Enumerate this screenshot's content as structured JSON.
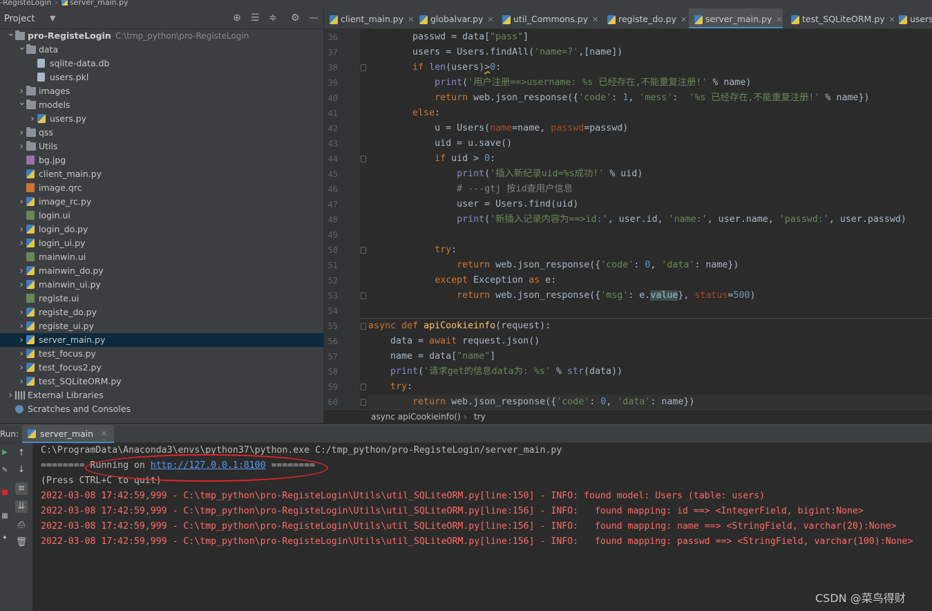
{
  "titlebar": {
    "project": "-RegisteLogin",
    "file": "server_main.py"
  },
  "project_panel": {
    "title": "Project"
  },
  "tree": [
    {
      "label": "pro-RegisteLogin",
      "path": "C:\\tmp_python\\pro-RegisteLogin",
      "depth": 0,
      "arrow": "open",
      "icon": "folder-icon",
      "bold": true
    },
    {
      "label": "data",
      "depth": 1,
      "arrow": "open",
      "icon": "folder-icon"
    },
    {
      "label": "sqlite-data.db",
      "depth": 2,
      "arrow": "none",
      "icon": "database-file-icon"
    },
    {
      "label": "users.pkl",
      "depth": 2,
      "arrow": "none",
      "icon": "file-icon"
    },
    {
      "label": "images",
      "depth": 1,
      "arrow": "closed",
      "icon": "folder-icon"
    },
    {
      "label": "models",
      "depth": 1,
      "arrow": "open",
      "icon": "folder-icon"
    },
    {
      "label": "users.py",
      "depth": 2,
      "arrow": "closed",
      "icon": "python-file-icon"
    },
    {
      "label": "qss",
      "depth": 1,
      "arrow": "closed",
      "icon": "folder-icon"
    },
    {
      "label": "Utils",
      "depth": 1,
      "arrow": "closed",
      "icon": "folder-icon"
    },
    {
      "label": "bg.jpg",
      "depth": 1,
      "arrow": "none",
      "icon": "image-file-icon"
    },
    {
      "label": "client_main.py",
      "depth": 1,
      "arrow": "none",
      "icon": "python-file-icon"
    },
    {
      "label": "image.qrc",
      "depth": 1,
      "arrow": "none",
      "icon": "qrc-file-icon"
    },
    {
      "label": "image_rc.py",
      "depth": 1,
      "arrow": "closed",
      "icon": "python-file-icon"
    },
    {
      "label": "login.ui",
      "depth": 1,
      "arrow": "none",
      "icon": "ui-file-icon"
    },
    {
      "label": "login_do.py",
      "depth": 1,
      "arrow": "closed",
      "icon": "python-file-icon"
    },
    {
      "label": "login_ui.py",
      "depth": 1,
      "arrow": "closed",
      "icon": "python-file-icon"
    },
    {
      "label": "mainwin.ui",
      "depth": 1,
      "arrow": "none",
      "icon": "ui-file-icon"
    },
    {
      "label": "mainwin_do.py",
      "depth": 1,
      "arrow": "closed",
      "icon": "python-file-icon"
    },
    {
      "label": "mainwin_ui.py",
      "depth": 1,
      "arrow": "closed",
      "icon": "python-file-icon"
    },
    {
      "label": "registe.ui",
      "depth": 1,
      "arrow": "none",
      "icon": "ui-file-icon"
    },
    {
      "label": "registe_do.py",
      "depth": 1,
      "arrow": "closed",
      "icon": "python-file-icon"
    },
    {
      "label": "registe_ui.py",
      "depth": 1,
      "arrow": "closed",
      "icon": "python-file-icon"
    },
    {
      "label": "server_main.py",
      "depth": 1,
      "arrow": "closed",
      "icon": "python-file-icon",
      "selected": true
    },
    {
      "label": "test_focus.py",
      "depth": 1,
      "arrow": "closed",
      "icon": "python-file-icon"
    },
    {
      "label": "test_focus2.py",
      "depth": 1,
      "arrow": "closed",
      "icon": "python-file-icon"
    },
    {
      "label": "test_SQLiteORM.py",
      "depth": 1,
      "arrow": "closed",
      "icon": "python-file-icon"
    },
    {
      "label": "External Libraries",
      "depth": 0,
      "arrow": "closed",
      "icon": "library-icon"
    },
    {
      "label": "Scratches and Consoles",
      "depth": 0,
      "arrow": "none",
      "icon": "scratches-icon"
    }
  ],
  "tabs": [
    {
      "label": "client_main.py",
      "active": false
    },
    {
      "label": "globalvar.py",
      "active": false
    },
    {
      "label": "util_Commons.py",
      "active": false
    },
    {
      "label": "registe_do.py",
      "active": false
    },
    {
      "label": "server_main.py",
      "active": true
    },
    {
      "label": "test_SQLiteORM.py",
      "active": false
    },
    {
      "label": "users",
      "active": false
    }
  ],
  "line_numbers": [
    "36",
    "37",
    "38",
    "39",
    "40",
    "41",
    "42",
    "43",
    "44",
    "45",
    "46",
    "47",
    "48",
    "49",
    "50",
    "51",
    "52",
    "53",
    "54",
    "55",
    "56",
    "57",
    "58",
    "59",
    "60"
  ],
  "code_lines": [
    {
      "indent": "        ",
      "tokens": [
        [
          "",
          "passwd = data["
        ],
        [
          "st",
          "\"pass\""
        ],
        [
          "",
          "]"
        ]
      ]
    },
    {
      "indent": "        ",
      "tokens": [
        [
          "",
          "users = Users.findAll("
        ],
        [
          "st",
          "'name=?'"
        ],
        [
          "",
          ",[name])"
        ]
      ]
    },
    {
      "indent": "        ",
      "tokens": [
        [
          "kw",
          "if "
        ],
        [
          "bi",
          "len"
        ],
        [
          "",
          "(users)"
        ],
        [
          "und",
          ">"
        ],
        [
          "nu",
          "0"
        ],
        [
          "",
          ":"
        ]
      ]
    },
    {
      "indent": "            ",
      "tokens": [
        [
          "bi",
          "print"
        ],
        [
          "",
          "("
        ],
        [
          "st",
          "'用户注册==>username: %s 已经存在,不能重复注册!'"
        ],
        [
          "",
          " % name)"
        ]
      ]
    },
    {
      "indent": "            ",
      "tokens": [
        [
          "kw",
          "return "
        ],
        [
          "",
          "web.json_response({"
        ],
        [
          "st",
          "'code'"
        ],
        [
          "",
          ": "
        ],
        [
          "nu",
          "1"
        ],
        [
          "",
          ", "
        ],
        [
          "st",
          "'mess'"
        ],
        [
          "",
          ":  "
        ],
        [
          "st",
          "'%s 已经存在,不能重复注册!'"
        ],
        [
          "",
          " % name})"
        ]
      ]
    },
    {
      "indent": "        ",
      "tokens": [
        [
          "kw",
          "else"
        ],
        [
          "",
          ":"
        ]
      ]
    },
    {
      "indent": "            ",
      "tokens": [
        [
          "",
          "u = Users("
        ],
        [
          "pa",
          "name"
        ],
        [
          "",
          "=name, "
        ],
        [
          "pa",
          "passwd"
        ],
        [
          "",
          "=passwd)"
        ]
      ]
    },
    {
      "indent": "            ",
      "tokens": [
        [
          "",
          "uid = u.save()"
        ]
      ]
    },
    {
      "indent": "            ",
      "tokens": [
        [
          "kw",
          "if "
        ],
        [
          "",
          "uid > "
        ],
        [
          "nu",
          "0"
        ],
        [
          "",
          ":"
        ]
      ]
    },
    {
      "indent": "                ",
      "tokens": [
        [
          "bi",
          "print"
        ],
        [
          "",
          "("
        ],
        [
          "st",
          "'插入新纪录uid=%s成功!'"
        ],
        [
          "",
          " % uid)"
        ]
      ]
    },
    {
      "indent": "                ",
      "tokens": [
        [
          "cm",
          "# ---gtj 按id查用户信息"
        ]
      ]
    },
    {
      "indent": "                ",
      "tokens": [
        [
          "",
          "user = Users.find(uid)"
        ]
      ]
    },
    {
      "indent": "                ",
      "tokens": [
        [
          "bi",
          "print"
        ],
        [
          "",
          "("
        ],
        [
          "st",
          "'新插入记录内容为==>id:'"
        ],
        [
          "",
          ", user.id, "
        ],
        [
          "st",
          "'name:'"
        ],
        [
          "",
          ", user.name, "
        ],
        [
          "st",
          "'passwd:'"
        ],
        [
          "",
          ", user.passwd)"
        ]
      ]
    },
    {
      "indent": "",
      "tokens": []
    },
    {
      "indent": "            ",
      "tokens": [
        [
          "kw",
          "try"
        ],
        [
          "",
          ":"
        ]
      ]
    },
    {
      "indent": "                ",
      "tokens": [
        [
          "kw",
          "return "
        ],
        [
          "",
          "web.json_response({"
        ],
        [
          "st",
          "'code'"
        ],
        [
          "",
          ": "
        ],
        [
          "nu",
          "0"
        ],
        [
          "",
          ", "
        ],
        [
          "st",
          "'data'"
        ],
        [
          "",
          ": name})"
        ]
      ]
    },
    {
      "indent": "            ",
      "tokens": [
        [
          "kw",
          "except "
        ],
        [
          "",
          "Exception "
        ],
        [
          "kw",
          "as "
        ],
        [
          "",
          "e:"
        ]
      ]
    },
    {
      "indent": "                ",
      "tokens": [
        [
          "kw",
          "return "
        ],
        [
          "",
          "web.json_response({"
        ],
        [
          "st",
          "'msg'"
        ],
        [
          "",
          ": e."
        ],
        [
          "hl",
          "value"
        ],
        [
          "",
          "}, "
        ],
        [
          "pa",
          "status"
        ],
        [
          "",
          "="
        ],
        [
          "nu",
          "500"
        ],
        [
          "",
          ")"
        ]
      ]
    },
    {
      "indent": "",
      "tokens": []
    },
    {
      "indent": "",
      "tokens": [
        [
          "kw",
          "async def "
        ],
        [
          "fn",
          "apiCookieinfo"
        ],
        [
          "",
          "(request):"
        ]
      ]
    },
    {
      "indent": "    ",
      "tokens": [
        [
          "",
          "data = "
        ],
        [
          "kw",
          "await "
        ],
        [
          "",
          "request.json()"
        ]
      ]
    },
    {
      "indent": "    ",
      "tokens": [
        [
          "",
          "name = data["
        ],
        [
          "st",
          "\"name\""
        ],
        [
          "",
          "]"
        ]
      ]
    },
    {
      "indent": "    ",
      "tokens": [
        [
          "bi",
          "print"
        ],
        [
          "",
          "("
        ],
        [
          "st",
          "'请求get的信息data为: %s'"
        ],
        [
          "",
          " % "
        ],
        [
          "bi",
          "str"
        ],
        [
          "",
          "(data))"
        ]
      ]
    },
    {
      "indent": "    ",
      "tokens": [
        [
          "kw",
          "try"
        ],
        [
          "",
          ":"
        ]
      ]
    },
    {
      "indent": "        ",
      "tokens": [
        [
          "kw",
          "return "
        ],
        [
          "",
          "web.json_response({"
        ],
        [
          "st",
          "'code'"
        ],
        [
          "",
          ": "
        ],
        [
          "nu",
          "0"
        ],
        [
          "",
          ", "
        ],
        [
          "st",
          "'data'"
        ],
        [
          "",
          ": name})"
        ]
      ],
      "current": true
    }
  ],
  "breadcrumb": {
    "item1": "async apiCookieinfo()",
    "sep": "›",
    "item2": "try"
  },
  "run": {
    "label": "Run:",
    "tab": "server_main",
    "lines": [
      {
        "text": "C:\\ProgramData\\Anaconda3\\envs\\python37\\python.exe C:/tmp_python/pro-RegisteLogin/server_main.py",
        "type": "normal"
      },
      {
        "text_before": "======== Running on ",
        "link": "http://127.0.0.1:8100",
        "text_after": " ========",
        "type": "link"
      },
      {
        "text": "(Press CTRL+C to quit)",
        "type": "normal"
      },
      {
        "text": "2022-03-08 17:42:59,999 - C:\\tmp_python\\pro-RegisteLogin\\Utils\\util_SQLiteORM.py[line:150] - INFO: found model: Users (table: users)",
        "type": "err"
      },
      {
        "text": "2022-03-08 17:42:59,999 - C:\\tmp_python\\pro-RegisteLogin\\Utils\\util_SQLiteORM.py[line:156] - INFO:   found mapping: id ==> <IntegerField, bigint:None>",
        "type": "err"
      },
      {
        "text": "2022-03-08 17:42:59,999 - C:\\tmp_python\\pro-RegisteLogin\\Utils\\util_SQLiteORM.py[line:156] - INFO:   found mapping: name ==> <StringField, varchar(20):None>",
        "type": "err"
      },
      {
        "text": "2022-03-08 17:42:59,999 - C:\\tmp_python\\pro-RegisteLogin\\Utils\\util_SQLiteORM.py[line:156] - INFO:   found mapping: passwd ==> <StringField, varchar(100):None>",
        "type": "err"
      }
    ]
  },
  "watermark": "CSDN @菜鸟得财",
  "colors": {
    "keyword": "#cc7832",
    "string": "#6a8759",
    "number": "#6897bb",
    "error": "#ff6b68",
    "link": "#589df6",
    "annotation": "#e0262b"
  }
}
